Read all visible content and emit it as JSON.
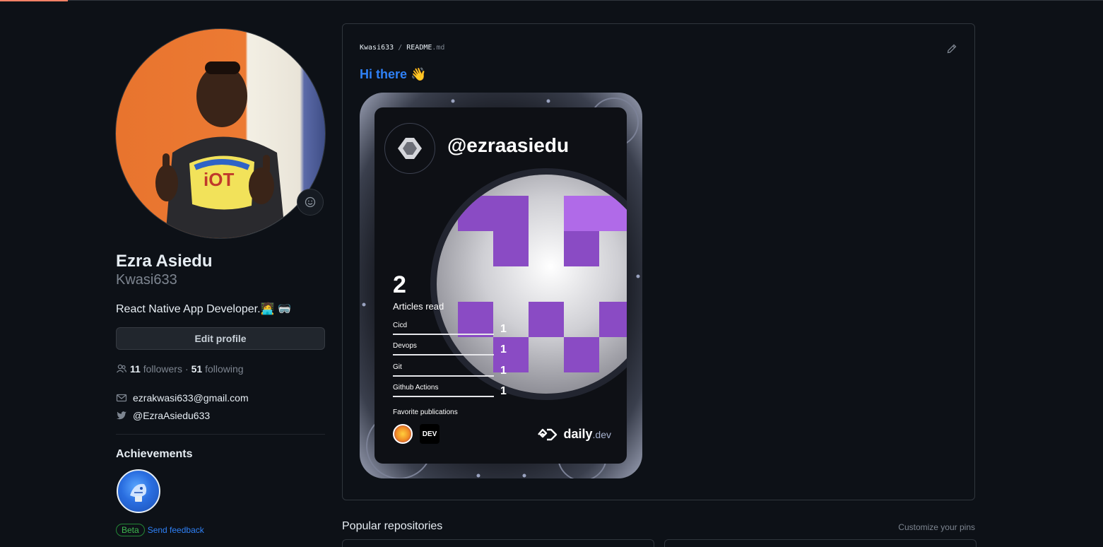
{
  "profile": {
    "full_name": "Ezra Asiedu",
    "username": "Kwasi633",
    "bio": "React Native App Developer.🧑‍💻 🥽",
    "edit_profile_label": "Edit profile",
    "followers_count": "11",
    "followers_label": "followers",
    "separator": "·",
    "following_count": "51",
    "following_label": "following",
    "email": "ezrakwasi633@gmail.com",
    "twitter": "@EzraAsiedu633"
  },
  "achievements": {
    "title": "Achievements",
    "beta_label": "Beta",
    "feedback_label": "Send feedback"
  },
  "readme": {
    "owner": "Kwasi633",
    "path_sep": "/",
    "file_name": "README",
    "file_ext": ".md",
    "greeting": "Hi there 👋"
  },
  "devcard": {
    "handle": "@ezraasiedu",
    "articles_count": "2",
    "articles_label": "Articles read",
    "tags": [
      {
        "name": "Cicd",
        "count": "1"
      },
      {
        "name": "Devops",
        "count": "1"
      },
      {
        "name": "Git",
        "count": "1"
      },
      {
        "name": "Github Actions",
        "count": "1"
      }
    ],
    "favorite_label": "Favorite publications",
    "pub2_label": "DEV",
    "brand_name": "daily",
    "brand_suffix": ".dev"
  },
  "repos": {
    "title": "Popular repositories",
    "customize_label": "Customize your pins"
  },
  "colors": {
    "background": "#0d1117",
    "link": "#2f81f7",
    "muted": "#7d8590",
    "border": "#30363d",
    "card_purple": "#8a4bc4"
  }
}
